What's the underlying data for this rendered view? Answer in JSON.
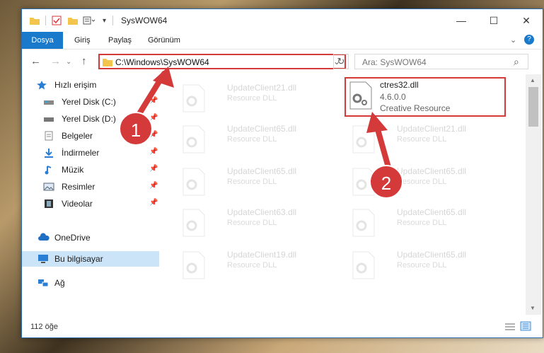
{
  "window": {
    "title": "SysWOW64",
    "minimize": "—",
    "maximize": "☐",
    "close": "✕"
  },
  "ribbon": {
    "tabs": [
      "Dosya",
      "Giriş",
      "Paylaş",
      "Görünüm"
    ],
    "help": "?"
  },
  "nav": {
    "back": "←",
    "forward": "→",
    "up": "↑",
    "path": "C:\\Windows\\SysWOW64",
    "dropdown": "⌄",
    "refresh": "↻",
    "search_placeholder": "Ara: SysWOW64",
    "search_icon": "⌕"
  },
  "sidebar": {
    "quick_access": "Hızlı erişim",
    "items": [
      {
        "label": "Yerel Disk (C:)",
        "icon": "drive-icon"
      },
      {
        "label": "Yerel Disk (D:)",
        "icon": "drive-icon"
      },
      {
        "label": "Belgeler",
        "icon": "documents-icon"
      },
      {
        "label": "İndirmeler",
        "icon": "downloads-icon"
      },
      {
        "label": "Müzik",
        "icon": "music-icon"
      },
      {
        "label": "Resimler",
        "icon": "pictures-icon"
      },
      {
        "label": "Videolar",
        "icon": "videos-icon"
      }
    ],
    "onedrive": "OneDrive",
    "this_pc": "Bu bilgisayar",
    "network": "Ağ"
  },
  "files": {
    "left": [
      {
        "name": "UpdateClient21.dll",
        "desc": "Resource DLL"
      },
      {
        "name": "UpdateClient65.dll",
        "desc": "Resource DLL"
      },
      {
        "name": "UpdateClient65.dll",
        "desc": "Resource DLL"
      },
      {
        "name": "UpdateClient63.dll",
        "desc": "Resource DLL"
      },
      {
        "name": "UpdateClient19.dll",
        "desc": "Resource DLL"
      }
    ],
    "right": [
      {
        "name": "ctres32.dll",
        "version": "4.6.0.0",
        "desc": "Creative Resource"
      },
      {
        "name": "UpdateClient21.dll",
        "desc": "Resource DLL"
      },
      {
        "name": "UpdateClient65.dll",
        "desc": "Resource DLL"
      },
      {
        "name": "UpdateClient65.dll",
        "desc": "Resource DLL"
      },
      {
        "name": "UpdateClient65.dll",
        "desc": "Resource DLL"
      }
    ]
  },
  "annotations": {
    "step1": "1",
    "step2": "2"
  },
  "status": {
    "count": "112 öğe"
  },
  "colors": {
    "accent": "#1979ca",
    "highlight": "#d43a3a",
    "selected": "#cce4f7"
  }
}
